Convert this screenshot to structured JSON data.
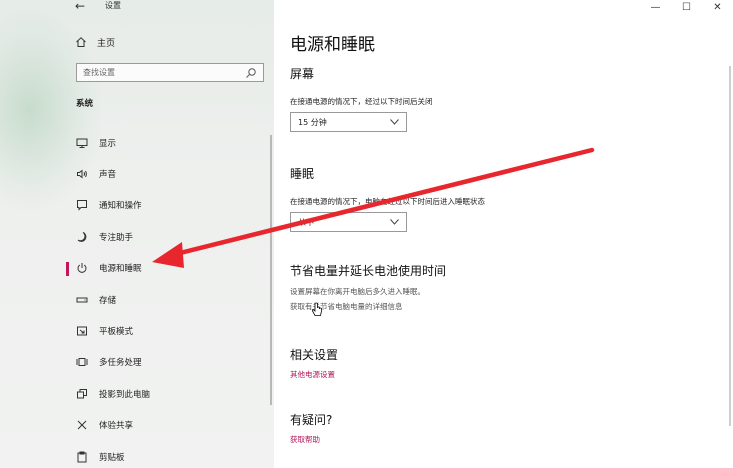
{
  "window": {
    "app_title": "设置",
    "back_icon": "back-arrow-icon",
    "controls": {
      "minimize": "—",
      "maximize": "☐",
      "close": "✕"
    }
  },
  "sidebar": {
    "home_label": "主页",
    "search_placeholder": "查找设置",
    "section": "系统",
    "items": [
      {
        "label": "显示",
        "icon": "display-icon"
      },
      {
        "label": "声音",
        "icon": "sound-icon"
      },
      {
        "label": "通知和操作",
        "icon": "notification-icon"
      },
      {
        "label": "专注助手",
        "icon": "moon-icon"
      },
      {
        "label": "电源和睡眠",
        "icon": "power-icon",
        "active": true
      },
      {
        "label": "存储",
        "icon": "storage-icon"
      },
      {
        "label": "平板模式",
        "icon": "tablet-icon"
      },
      {
        "label": "多任务处理",
        "icon": "multitask-icon"
      },
      {
        "label": "投影到此电脑",
        "icon": "project-icon"
      },
      {
        "label": "体验共享",
        "icon": "share-icon"
      },
      {
        "label": "剪贴板",
        "icon": "clipboard-icon"
      }
    ]
  },
  "main": {
    "title": "电源和睡眠",
    "screen": {
      "heading": "屏幕",
      "label": "在接通电源的情况下，经过以下时间后关闭",
      "value": "15 分钟"
    },
    "sleep": {
      "heading": "睡眠",
      "label": "在接通电源的情况下，电脑在经过以下时间后进入睡眠状态",
      "value": "从不"
    },
    "battery": {
      "heading": "节省电量并延长电池使用时间",
      "desc": "设置屏幕在你离开电脑后多久进入睡眠。",
      "link": "获取有关节省电脑电量的详细信息"
    },
    "related": {
      "heading": "相关设置",
      "link": "其他电源设置"
    },
    "help": {
      "heading": "有疑问?",
      "link": "获取帮助"
    }
  },
  "annotation": {
    "arrow_color": "#e8262d"
  },
  "colors": {
    "accent": "#c2185b",
    "link": "#b0155a"
  }
}
